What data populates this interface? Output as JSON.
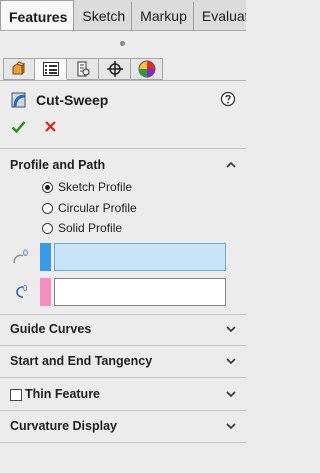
{
  "tabs": [
    {
      "label": "Features",
      "active": true
    },
    {
      "label": "Sketch",
      "active": false
    },
    {
      "label": "Markup",
      "active": false
    },
    {
      "label": "Evaluate",
      "active": false
    }
  ],
  "manager_icons": [
    "feature-manager-icon",
    "property-manager-icon",
    "configuration-manager-icon",
    "dimxpert-manager-icon",
    "display-manager-icon"
  ],
  "feature": {
    "title": "Cut-Sweep",
    "help_icon": "help-icon",
    "ok_icon": "checkmark-icon",
    "cancel_icon": "cross-icon"
  },
  "profile_and_path": {
    "heading": "Profile and Path",
    "options": [
      {
        "label": "Sketch Profile",
        "checked": true
      },
      {
        "label": "Circular Profile",
        "checked": false
      },
      {
        "label": "Solid Profile",
        "checked": false
      }
    ],
    "profile_value": "",
    "path_value": "",
    "profile_color": "#3a9ae8",
    "path_color": "#f48ec0"
  },
  "sections": {
    "guide_curves": "Guide Curves",
    "tangency": "Start and End Tangency",
    "thin_feature": "Thin Feature",
    "curvature_display": "Curvature Display"
  },
  "colors": {
    "ok_green": "#2e8b22",
    "cancel_red": "#d12a1e",
    "accent_blue": "#3a9ae8"
  }
}
